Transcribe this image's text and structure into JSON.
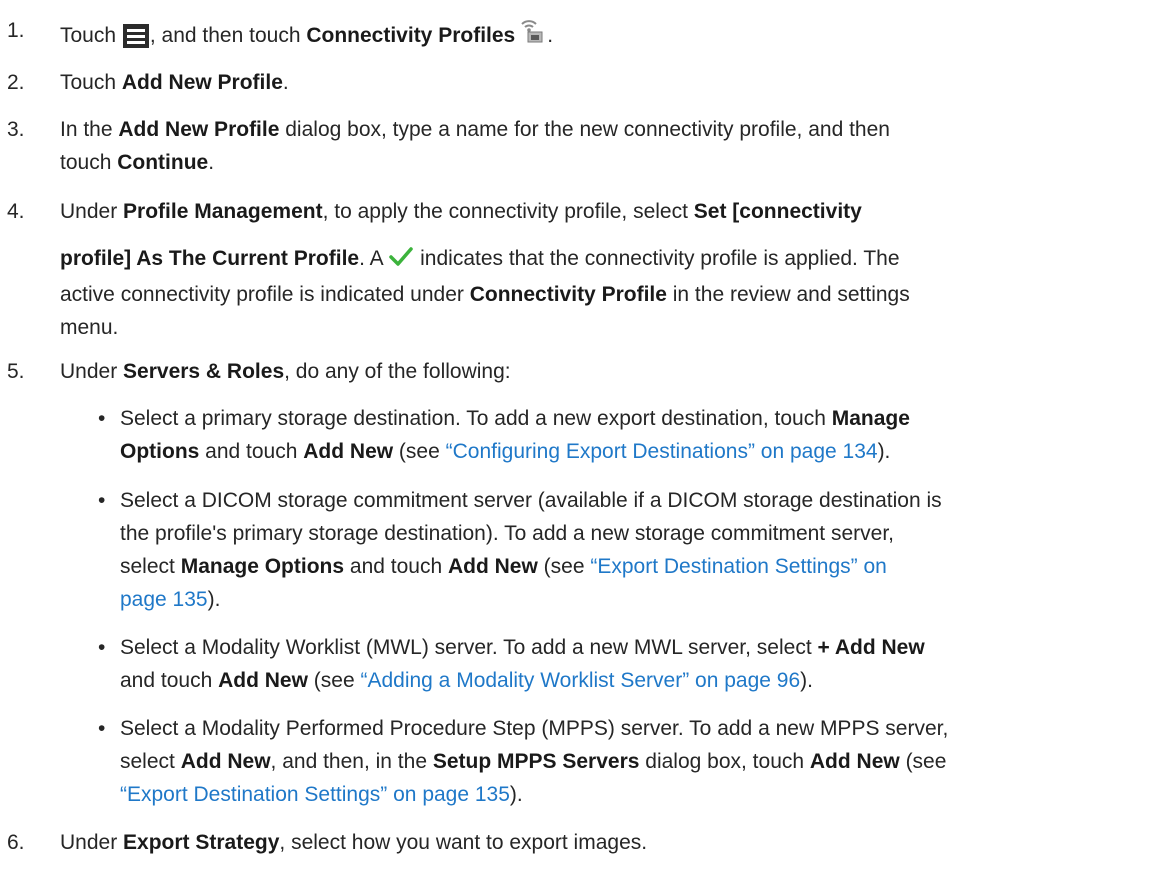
{
  "steps": [
    {
      "n": "1.",
      "a": "Touch ",
      "b": ", and then touch ",
      "c": "Connectivity Profiles",
      "d": "."
    },
    {
      "n": "2.",
      "a": "Touch ",
      "b": "Add New Profile",
      "c": "."
    },
    {
      "n": "3.",
      "a": "In the ",
      "b": "Add New Profile",
      "c": " dialog box, type a name for the new connectivity profile, and then",
      "d": "touch ",
      "e": "Continue",
      "f": "."
    },
    {
      "n": "4.",
      "a": "Under ",
      "b": "Profile Management",
      "c": ", to apply the connectivity profile, select ",
      "d": "Set [connectivity",
      "e": "profile] As The Current Profile",
      "f": ". A ",
      "g": " indicates that the connectivity profile is applied. The",
      "h": "active connectivity profile is indicated under ",
      "i": "Connectivity Profile",
      "j": " in the review and settings",
      "k": "menu."
    },
    {
      "n": "5.",
      "a": "Under ",
      "b": "Servers & Roles",
      "c": ", do any of the following:"
    },
    {
      "n": "6.",
      "a": "Under ",
      "b": "Export Strategy",
      "c": ", select how you want to export images."
    }
  ],
  "bullets": [
    {
      "a": "Select a primary storage destination. To add a new export destination, touch ",
      "b": "Manage",
      "c": "Options",
      "d": " and touch ",
      "e": "Add New",
      "f": " (see ",
      "g": "“Configuring Export Destinations” on page 134",
      "h": ")."
    },
    {
      "a": "Select a DICOM storage commitment server (available if a DICOM storage destination is",
      "b": "the profile's primary storage destination). To add a new storage commitment server,",
      "c": "select ",
      "d": "Manage Options",
      "e": " and touch ",
      "f": "Add New",
      "g": " (see ",
      "h": "“Export Destination Settings” on",
      "i": "page 135",
      "j": ")."
    },
    {
      "a": "Select a Modality Worklist (MWL) server. To add a new MWL server, select ",
      "b": "+ Add New",
      "c": "and touch ",
      "d": "Add New",
      "e": " (see ",
      "f": "“Adding a Modality Worklist Server” on page 96",
      "g": ")."
    },
    {
      "a": "Select a Modality Performed Procedure Step (MPPS) server. To add a new MPPS server,",
      "b": "select ",
      "c": "Add New",
      "d": ", and then, in the ",
      "e": "Setup MPPS Servers",
      "f": " dialog box, touch ",
      "g": "Add New",
      "h": " (see",
      "i": "“Export Destination Settings” on page 135",
      "j": ")."
    }
  ],
  "bullet_char": "•",
  "icons": [
    "menu-icon",
    "connectivity-profiles-icon",
    "checkmark-icon"
  ],
  "colors": {
    "text": "#262626",
    "link": "#1f78c8",
    "check": "#3cb33c"
  }
}
